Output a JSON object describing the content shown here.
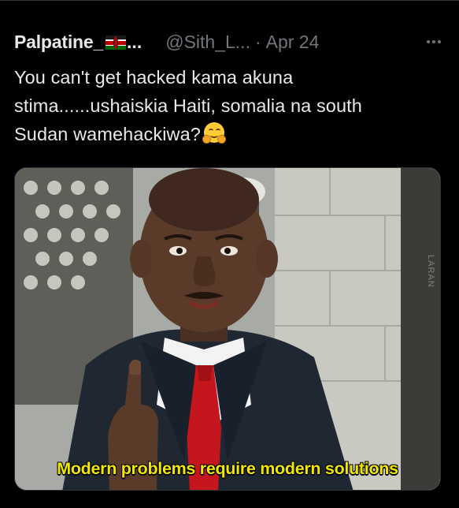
{
  "tweet": {
    "display_name": "Palpatine_",
    "name_truncation": "...",
    "flag_icon": "kenya-flag-icon",
    "handle": "@Sith_L...",
    "separator": "·",
    "date": "Apr 24",
    "more_icon": "more-horizontal-icon",
    "text_lines": [
      "You can't get hacked kama akuna",
      "stima......ushaiskia Haiti, somalia na south",
      "Sudan wamehackiwa?"
    ],
    "text_emoji": "hugging-face-emoji",
    "media": {
      "caption": "Modern problems require modern solutions",
      "watermark": "LARAN"
    }
  },
  "colors": {
    "background": "#000000",
    "primary_text": "#e7e9ea",
    "secondary_text": "#71767b",
    "divider": "#2f3336",
    "caption_yellow": "#f0e800"
  }
}
